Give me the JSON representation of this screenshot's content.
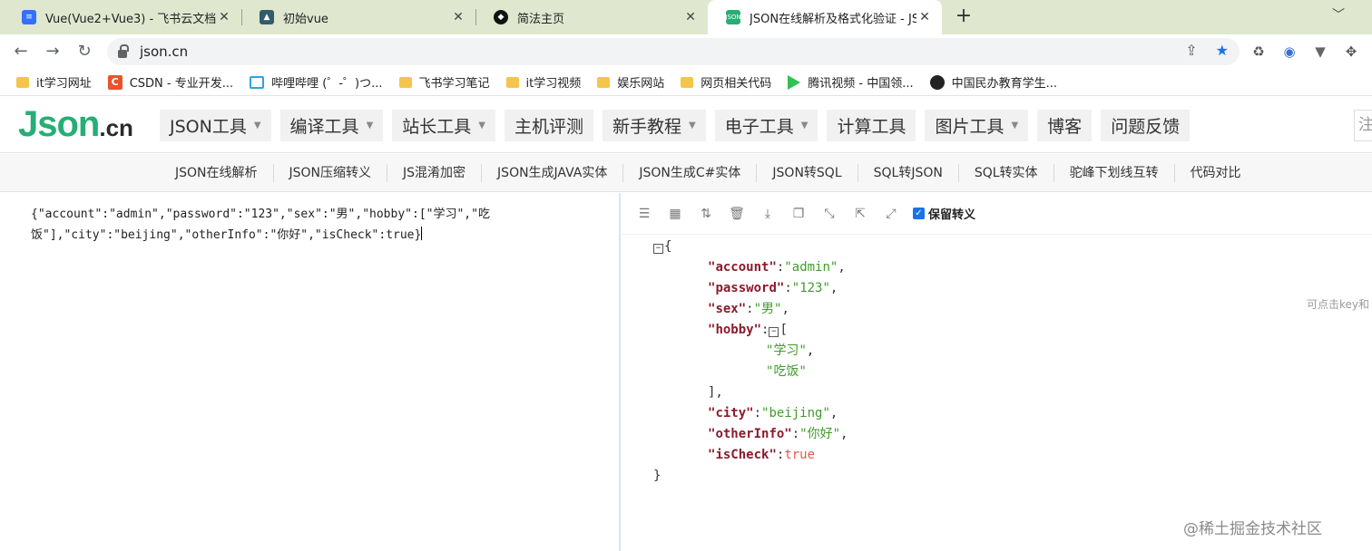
{
  "tabs": [
    {
      "title": "Vue(Vue2+Vue3) - 飞书云文档",
      "icon": "doc-icon",
      "color": "#3370ff",
      "active": false
    },
    {
      "title": "初始vue",
      "icon": "image-icon",
      "color": "#2f5d6a",
      "active": false
    },
    {
      "title": "简法主页",
      "icon": "shield-icon",
      "color": "#111111",
      "active": false
    },
    {
      "title": "JSON在线解析及格式化验证 - JS",
      "icon": "json-icon",
      "color": "#27ae74",
      "active": true
    }
  ],
  "address": {
    "url": "json.cn"
  },
  "bookmarks": [
    {
      "label": "it学习网址",
      "icon": "folder-icon"
    },
    {
      "label": "CSDN - 专业开发...",
      "icon": "csdn-icon"
    },
    {
      "label": "哔哩哔哩 (゜-゜)つ...",
      "icon": "bilibili-icon"
    },
    {
      "label": "飞书学习笔记",
      "icon": "folder-icon"
    },
    {
      "label": "it学习视频",
      "icon": "folder-icon"
    },
    {
      "label": "娱乐网站",
      "icon": "folder-icon"
    },
    {
      "label": "网页相关代码",
      "icon": "folder-icon"
    },
    {
      "label": "腾讯视频 - 中国领...",
      "icon": "tencent-video-icon"
    },
    {
      "label": "中国民办教育学生...",
      "icon": "globe-icon"
    }
  ],
  "site": {
    "logo_main": "Json",
    "logo_suffix": ".cn",
    "nav": [
      {
        "label": "JSON工具",
        "dropdown": true
      },
      {
        "label": "编译工具",
        "dropdown": true
      },
      {
        "label": "站长工具",
        "dropdown": true
      },
      {
        "label": "主机评测",
        "dropdown": false
      },
      {
        "label": "新手教程",
        "dropdown": true
      },
      {
        "label": "电子工具",
        "dropdown": true
      },
      {
        "label": "计算工具",
        "dropdown": false
      },
      {
        "label": "图片工具",
        "dropdown": true
      },
      {
        "label": "博客",
        "dropdown": false
      },
      {
        "label": "问题反馈",
        "dropdown": false
      }
    ],
    "nav_edge_text": "注",
    "subnav": [
      "JSON在线解析",
      "JSON压缩转义",
      "JS混淆加密",
      "JSON生成JAVA实体",
      "JSON生成C#实体",
      "JSON转SQL",
      "SQL转JSON",
      "SQL转实体",
      "驼峰下划线互转",
      "代码对比"
    ]
  },
  "editor": {
    "raw_text": "{\"account\":\"admin\",\"password\":\"123\",\"sex\":\"男\",\"hobby\":[\"学习\",\"吃饭\"],\"city\":\"beijing\",\"otherInfo\":\"你好\",\"isCheck\":true}"
  },
  "viewer": {
    "keep_escape_label": "保留转义",
    "keep_escape_checked": true,
    "tree": [
      {
        "indent": 0,
        "fold": true,
        "text": "{"
      },
      {
        "indent": 1,
        "key": "account",
        "value": "admin",
        "type": "string",
        "comma": true
      },
      {
        "indent": 1,
        "key": "password",
        "value": "123",
        "type": "string",
        "comma": true
      },
      {
        "indent": 1,
        "key": "sex",
        "value": "男",
        "type": "string",
        "comma": true
      },
      {
        "indent": 1,
        "key": "hobby",
        "open": "[",
        "fold": true
      },
      {
        "indent": 2,
        "value": "学习",
        "type": "string",
        "comma": true
      },
      {
        "indent": 2,
        "value": "吃饭",
        "type": "string",
        "comma": false
      },
      {
        "indent": 1,
        "close": "],"
      },
      {
        "indent": 1,
        "key": "city",
        "value": "beijing",
        "type": "string",
        "comma": true
      },
      {
        "indent": 1,
        "key": "otherInfo",
        "value": "你好",
        "type": "string",
        "comma": true
      },
      {
        "indent": 1,
        "key": "isCheck",
        "value": "true",
        "type": "bool",
        "comma": false
      },
      {
        "indent": 0,
        "close": "}"
      }
    ],
    "hint": "可点击key和",
    "watermark": "@稀土掘金技术社区"
  }
}
